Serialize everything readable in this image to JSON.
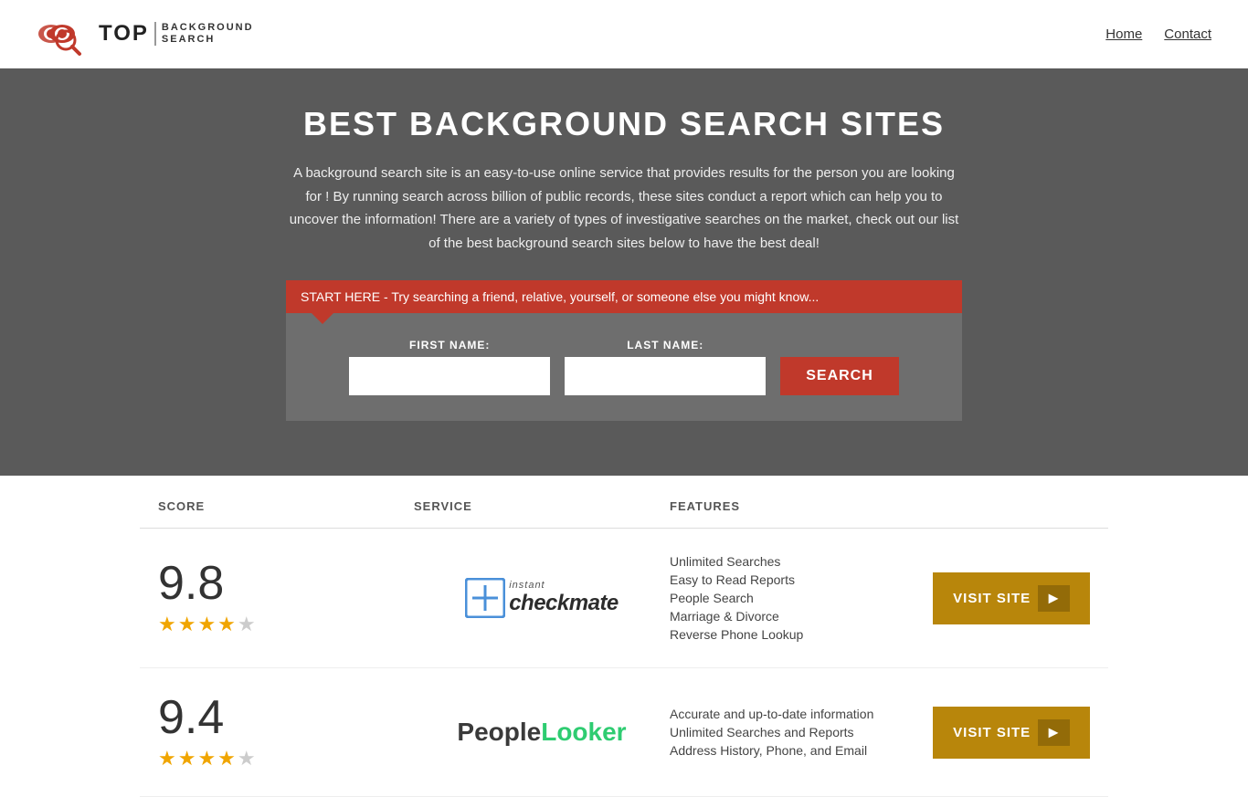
{
  "header": {
    "logo_top": "TOP",
    "logo_sub_line1": "BACKGROUND",
    "logo_sub_line2": "SEARCH",
    "nav": [
      {
        "label": "Home",
        "href": "#"
      },
      {
        "label": "Contact",
        "href": "#"
      }
    ]
  },
  "hero": {
    "title": "BEST BACKGROUND SEARCH SITES",
    "description": "A background search site is an easy-to-use online service that provides results  for the person you are looking for ! By  running  search across billion of public records, these sites conduct  a report which can help you to uncover the information! There are a variety of types of investigative searches on the market, check out our  list of the best background search sites below to have the best deal!",
    "callout": "START HERE - Try searching a friend, relative, yourself, or someone else you might know...",
    "first_name_label": "FIRST NAME:",
    "last_name_label": "LAST NAME:",
    "search_button": "SEARCH"
  },
  "table": {
    "columns": [
      "SCORE",
      "SERVICE",
      "FEATURES",
      ""
    ],
    "rows": [
      {
        "score": "9.8",
        "stars": "★★★★★",
        "service_name": "Instant Checkmate",
        "features": [
          "Unlimited Searches",
          "Easy to Read Reports",
          "People Search",
          "Marriage & Divorce",
          "Reverse Phone Lookup"
        ],
        "visit_label": "VISIT SITE"
      },
      {
        "score": "9.4",
        "stars": "★★★★★",
        "service_name": "PeopleLooker",
        "features": [
          "Accurate and up-to-date information",
          "Unlimited Searches and Reports",
          "Address History, Phone, and Email"
        ],
        "visit_label": "VISIT SITE"
      }
    ]
  }
}
